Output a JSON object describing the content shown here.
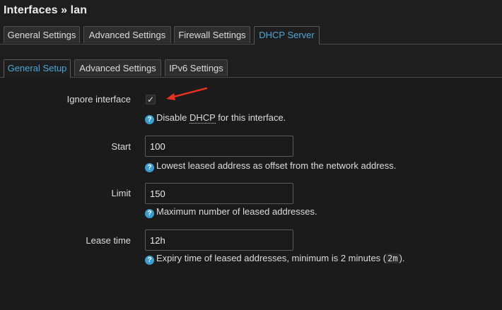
{
  "header": {
    "title": "Interfaces » lan"
  },
  "tabs": [
    {
      "label": "General Settings"
    },
    {
      "label": "Advanced Settings"
    },
    {
      "label": "Firewall Settings"
    },
    {
      "label": "DHCP Server"
    }
  ],
  "subtabs": [
    {
      "label": "General Setup"
    },
    {
      "label": "Advanced Settings"
    },
    {
      "label": "IPv6 Settings"
    }
  ],
  "fields": {
    "ignore_interface": {
      "label": "Ignore interface",
      "checked": true,
      "hint_prefix": "Disable ",
      "hint_abbr": "DHCP",
      "hint_suffix": " for this interface."
    },
    "start": {
      "label": "Start",
      "value": "100",
      "hint": "Lowest leased address as offset from the network address."
    },
    "limit": {
      "label": "Limit",
      "value": "150",
      "hint": "Maximum number of leased addresses."
    },
    "lease_time": {
      "label": "Lease time",
      "value": "12h",
      "hint_prefix": "Expiry time of leased addresses, minimum is 2 minutes (",
      "hint_code": "2m",
      "hint_suffix": ")."
    }
  },
  "colors": {
    "background": "#1e1e1e",
    "active_tab": "#48a8d8",
    "help_icon": "#3a9fd0",
    "annotation_arrow": "#e8321e"
  },
  "icons": {
    "help": "question-circle-icon",
    "check": "checkmark-icon",
    "annotation": "arrow-annotation-icon"
  }
}
